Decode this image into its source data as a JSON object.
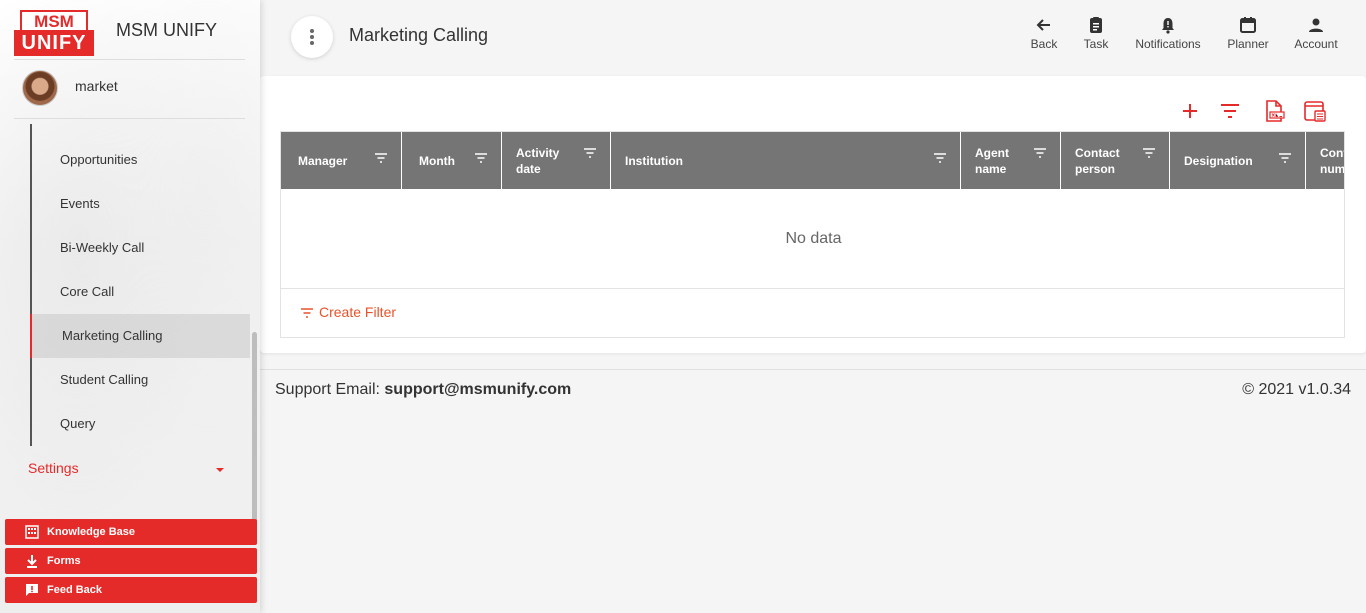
{
  "brand": {
    "logo_top": "MSM",
    "logo_bottom": "UNIFY",
    "name": "MSM UNIFY"
  },
  "user": {
    "name": "market"
  },
  "sidebar": {
    "items": [
      {
        "label": "Opportunities"
      },
      {
        "label": "Events"
      },
      {
        "label": "Bi-Weekly Call"
      },
      {
        "label": "Core Call"
      },
      {
        "label": "Marketing Calling"
      },
      {
        "label": "Student Calling"
      },
      {
        "label": "Query"
      }
    ],
    "active_item": "Marketing Calling",
    "settings_label": "Settings",
    "buttons": [
      {
        "label": "Knowledge Base",
        "icon": "building-icon"
      },
      {
        "label": "Forms",
        "icon": "download-icon"
      },
      {
        "label": "Feed Back",
        "icon": "feedback-icon"
      }
    ]
  },
  "header": {
    "title": "Marketing Calling",
    "actions": [
      {
        "label": "Back",
        "icon": "arrow-left-icon"
      },
      {
        "label": "Task",
        "icon": "clipboard-icon"
      },
      {
        "label": "Notifications",
        "icon": "bell-icon"
      },
      {
        "label": "Planner",
        "icon": "calendar-icon"
      },
      {
        "label": "Account",
        "icon": "person-icon"
      }
    ]
  },
  "toolbar": {
    "icons": [
      "add-icon",
      "filter-icon",
      "export-xls-icon",
      "column-select-icon"
    ]
  },
  "table": {
    "columns": [
      {
        "label": "Manager"
      },
      {
        "label": "Month"
      },
      {
        "label": "Activity date"
      },
      {
        "label": "Institution"
      },
      {
        "label": "Agent name"
      },
      {
        "label": "Contact person"
      },
      {
        "label": "Designation"
      },
      {
        "label": "Contact number"
      }
    ],
    "empty_text": "No data",
    "create_filter_label": "Create Filter"
  },
  "footer": {
    "support_label": "Support Email:",
    "support_email": "support@msmunify.com",
    "version": "© 2021 v1.0.34"
  },
  "colors": {
    "accent": "#e52a2a",
    "table_header": "#757575",
    "link": "#e8532b"
  }
}
